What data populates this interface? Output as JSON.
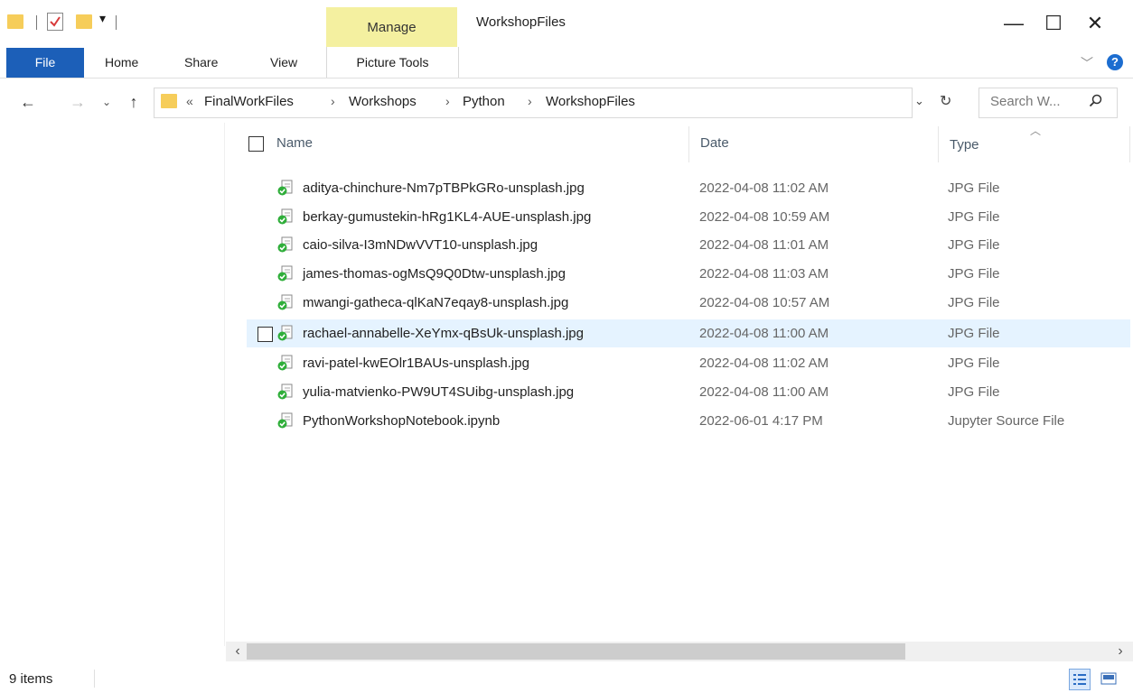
{
  "window": {
    "title": "WorkshopFiles",
    "context_tab": "Manage",
    "controls": {
      "minimize": "—",
      "maximize": "☐",
      "close": "✕"
    }
  },
  "ribbon": {
    "tabs": [
      "File",
      "Home",
      "Share",
      "View",
      "Picture Tools"
    ]
  },
  "address": {
    "overflow": "«",
    "crumbs": [
      "FinalWorkFiles",
      "Workshops",
      "Python",
      "WorkshopFiles"
    ],
    "separator": "›"
  },
  "search": {
    "placeholder": "Search W..."
  },
  "columns": {
    "name": "Name",
    "date": "Date",
    "type": "Type"
  },
  "files": [
    {
      "name": "aditya-chinchure-Nm7pTBPkGRo-unsplash.jpg",
      "date": "2022-04-08 11:02 AM",
      "type": "JPG File"
    },
    {
      "name": "berkay-gumustekin-hRg1KL4-AUE-unsplash.jpg",
      "date": "2022-04-08 10:59 AM",
      "type": "JPG File"
    },
    {
      "name": "caio-silva-I3mNDwVVT10-unsplash.jpg",
      "date": "2022-04-08 11:01 AM",
      "type": "JPG File"
    },
    {
      "name": "james-thomas-ogMsQ9Q0Dtw-unsplash.jpg",
      "date": "2022-04-08 11:03 AM",
      "type": "JPG File"
    },
    {
      "name": "mwangi-gatheca-qlKaN7eqay8-unsplash.jpg",
      "date": "2022-04-08 10:57 AM",
      "type": "JPG File"
    },
    {
      "name": "rachael-annabelle-XeYmx-qBsUk-unsplash.jpg",
      "date": "2022-04-08 11:00 AM",
      "type": "JPG File"
    },
    {
      "name": "ravi-patel-kwEOlr1BAUs-unsplash.jpg",
      "date": "2022-04-08 11:02 AM",
      "type": "JPG File"
    },
    {
      "name": "yulia-matvienko-PW9UT4SUibg-unsplash.jpg",
      "date": "2022-04-08 11:00 AM",
      "type": "JPG File"
    },
    {
      "name": "PythonWorkshopNotebook.ipynb",
      "date": "2022-06-01 4:17 PM",
      "type": "Jupyter Source File"
    }
  ],
  "status": {
    "item_count": "9 items"
  },
  "colors": {
    "file_tab": "#1c5fb8",
    "manage_tab": "#f4f0a0",
    "selection": "#e5f3ff",
    "sync_check": "#2fae3a"
  }
}
